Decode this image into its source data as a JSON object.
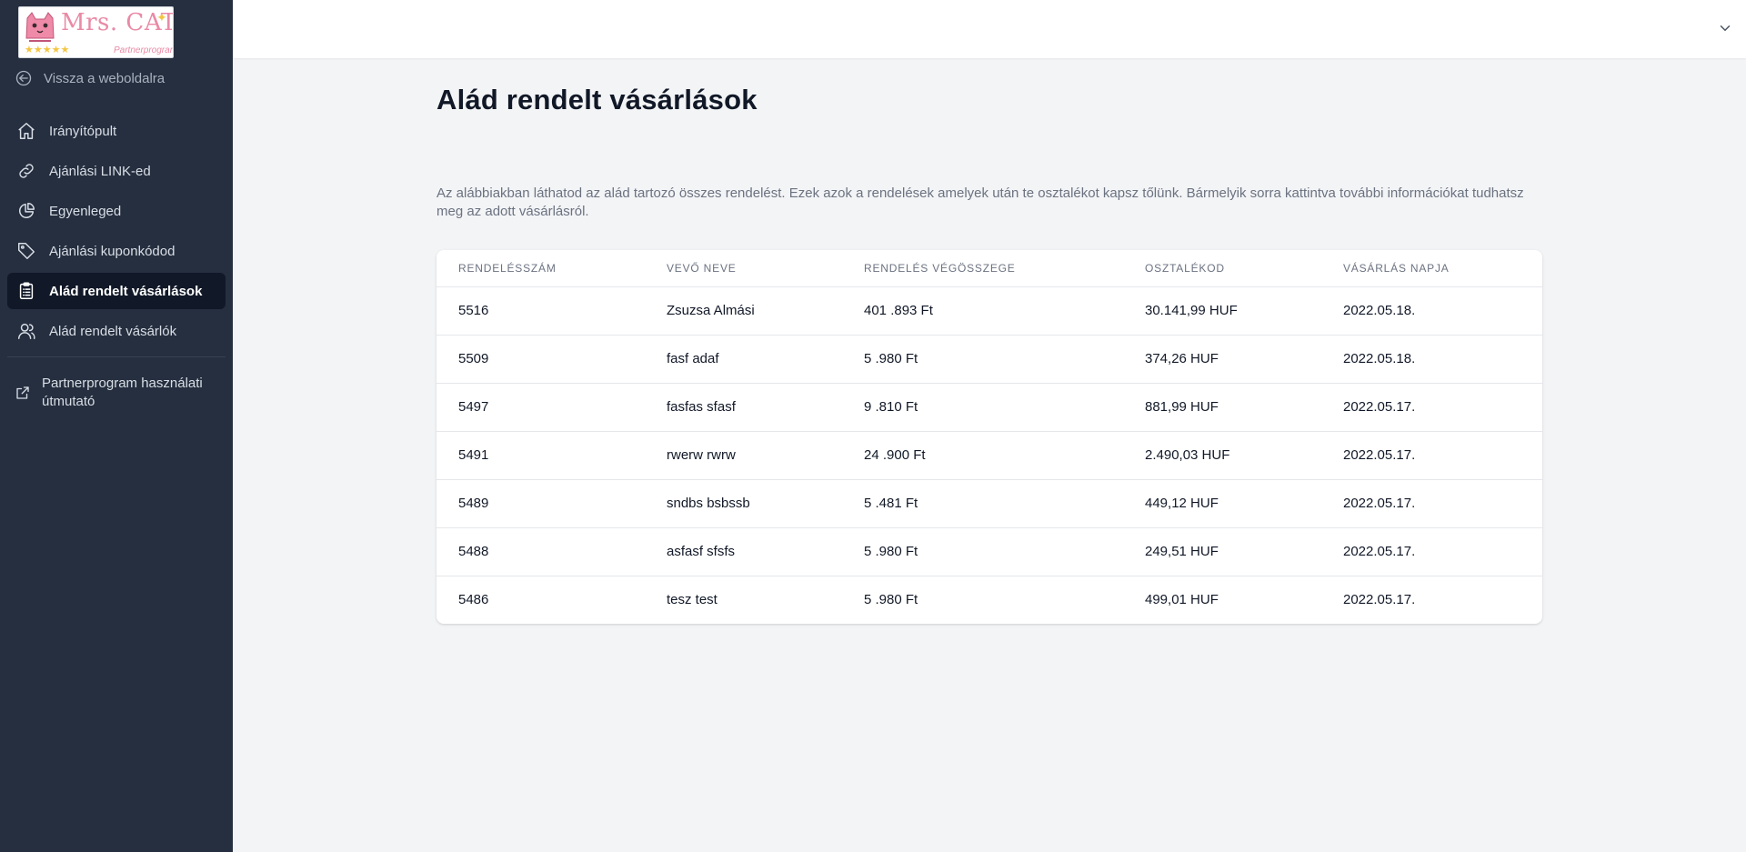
{
  "brand": {
    "logo_text": "Mrs. CAThy",
    "logo_subtitle": "Partnerprogram",
    "colors": {
      "sidebar": "#252f3f",
      "active": "#111827",
      "logo_pink": "#e98aa6",
      "star": "#f4c542"
    }
  },
  "sidebar": {
    "back_link": {
      "label": "Vissza a weboldalra",
      "icon": "arrow-circle-left-icon"
    },
    "items": [
      {
        "label": "Irányítópult",
        "icon": "home-icon",
        "active": false
      },
      {
        "label": "Ajánlási LINK-ed",
        "icon": "link-icon",
        "active": false
      },
      {
        "label": "Egyenleged",
        "icon": "chart-pie-icon",
        "active": false
      },
      {
        "label": "Ajánlási kuponkódod",
        "icon": "tag-icon",
        "active": false
      },
      {
        "label": "Alád rendelt vásárlások",
        "icon": "clipboard-list-icon",
        "active": true
      },
      {
        "label": "Alád rendelt vásárlók",
        "icon": "users-icon",
        "active": false
      }
    ],
    "guide": {
      "label": "Partnerprogram használati útmutató",
      "icon": "external-link-icon"
    }
  },
  "topbar": {
    "menu_icon": "chevron-down-icon"
  },
  "main": {
    "title": "Alád rendelt vásárlások",
    "description": "Az alábbiakban láthatod az alád tartozó összes rendelést. Ezek azok a rendelések amelyek után te osztalékot kapsz tőlünk. Bármelyik sorra kattintva további információkat tudhatsz meg az adott vásárlásról.",
    "table": {
      "columns": [
        "Rendelésszám",
        "Vevő neve",
        "Rendelés végösszege",
        "Osztalékod",
        "Vásárlás napja"
      ],
      "rows": [
        [
          "5516",
          "Zsuzsa Almási",
          "401 .893 Ft",
          "30.141,99 HUF",
          "2022.05.18."
        ],
        [
          "5509",
          "fasf adaf",
          "5 .980 Ft",
          "374,26 HUF",
          "2022.05.18."
        ],
        [
          "5497",
          "fasfas sfasf",
          "9 .810 Ft",
          "881,99 HUF",
          "2022.05.17."
        ],
        [
          "5491",
          "rwerw rwrw",
          "24 .900 Ft",
          "2.490,03 HUF",
          "2022.05.17."
        ],
        [
          "5489",
          "sndbs bsbssb",
          "5 .481 Ft",
          "449,12 HUF",
          "2022.05.17."
        ],
        [
          "5488",
          "asfasf sfsfs",
          "5 .980 Ft",
          "249,51 HUF",
          "2022.05.17."
        ],
        [
          "5486",
          "tesz test",
          "5 .980 Ft",
          "499,01 HUF",
          "2022.05.17."
        ]
      ]
    }
  }
}
